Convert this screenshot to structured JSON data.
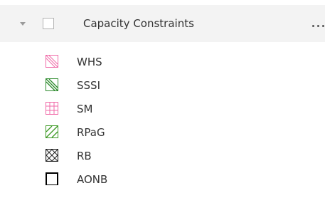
{
  "group": {
    "title": "Capacity Constraints",
    "expanded": true,
    "checked": false
  },
  "icons": {
    "expand": "chevron-down-icon",
    "more": "more-options-icon"
  },
  "colors": {
    "header_bg": "#f3f3f3",
    "whs": "#f06aa8",
    "sssi": "#2e8b2e",
    "sm": "#f06aa8",
    "rpag": "#3f9a26",
    "rb": "#222222",
    "aonb": "#000000"
  },
  "layers": [
    {
      "label": "WHS",
      "symbol": "pink-diagonal-hatch"
    },
    {
      "label": "SSSI",
      "symbol": "green-diagonal-hatch"
    },
    {
      "label": "SM",
      "symbol": "pink-grid"
    },
    {
      "label": "RPaG",
      "symbol": "green-diagonal-hatch"
    },
    {
      "label": "RB",
      "symbol": "black-cross-hatch"
    },
    {
      "label": "AONB",
      "symbol": "black-outline"
    }
  ]
}
